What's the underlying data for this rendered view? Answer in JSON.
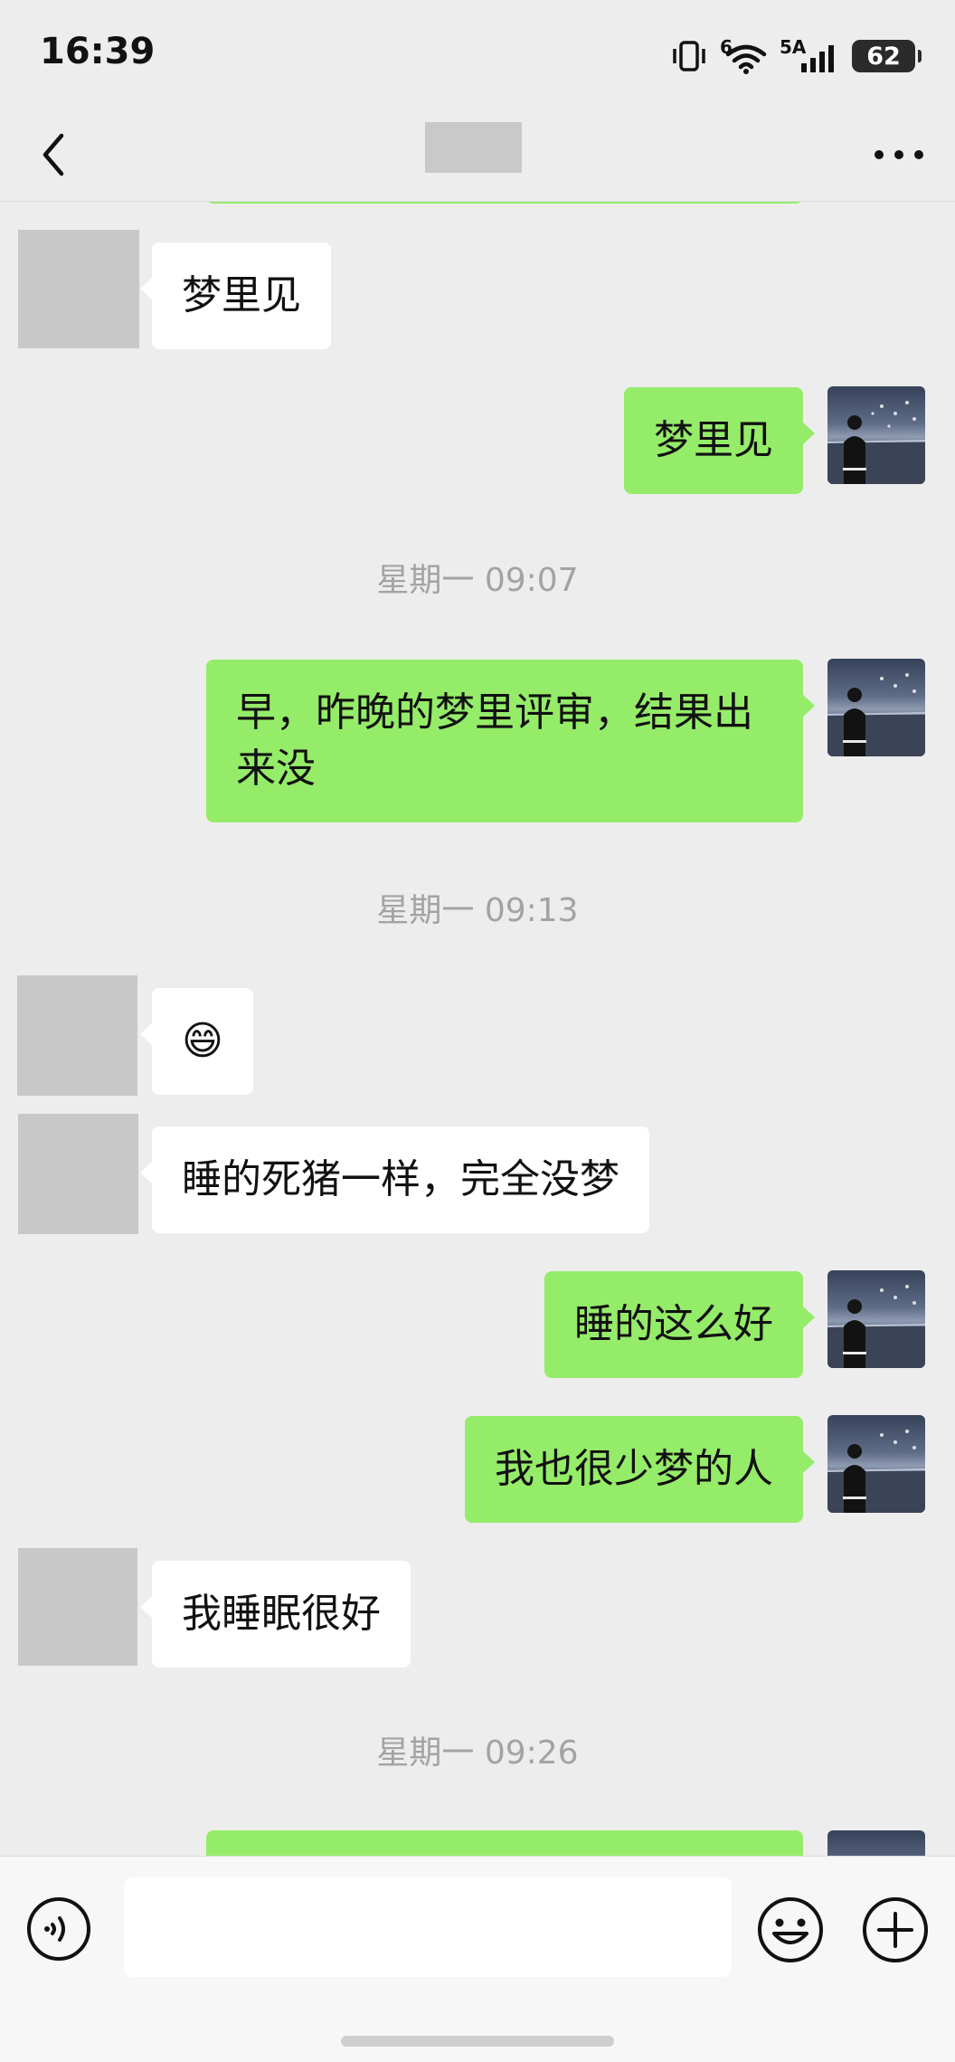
{
  "status_bar": {
    "time": "16:39",
    "network_label": "5A",
    "wifi_label": "6",
    "battery": "62",
    "icons": [
      "vibrate-icon",
      "wifi-icon",
      "signal-icon",
      "battery-icon"
    ]
  },
  "nav": {
    "back_icon": "chevron-left-icon",
    "more_icon": "more-horizontal-icon"
  },
  "messages": [
    {
      "side": "left",
      "text": "梦里见"
    },
    {
      "side": "right",
      "text": "梦里见"
    },
    {
      "type": "time",
      "text": "星期一 09:07"
    },
    {
      "side": "right",
      "lines": [
        "早，昨晚的梦里评审，结果出",
        "来没"
      ]
    },
    {
      "type": "time",
      "text": "星期一 09:13"
    },
    {
      "side": "left",
      "text": "😄"
    },
    {
      "side": "left",
      "text": "睡的死猪一样，完全没梦"
    },
    {
      "side": "right",
      "text": "睡的这么好"
    },
    {
      "side": "right",
      "text": "我也很少梦的人"
    },
    {
      "side": "left",
      "text": "我睡眠很好"
    },
    {
      "type": "time",
      "text": "星期一 09:26"
    }
  ],
  "colors": {
    "background": "#ededed",
    "sent_bubble": "#95ec69",
    "received_bubble": "#ffffff",
    "timestamp": "#a3a3a3"
  },
  "input_bar": {
    "voice_icon": "voice-icon",
    "emoji_icon": "emoji-icon",
    "plus_icon": "plus-icon",
    "text_value": ""
  }
}
